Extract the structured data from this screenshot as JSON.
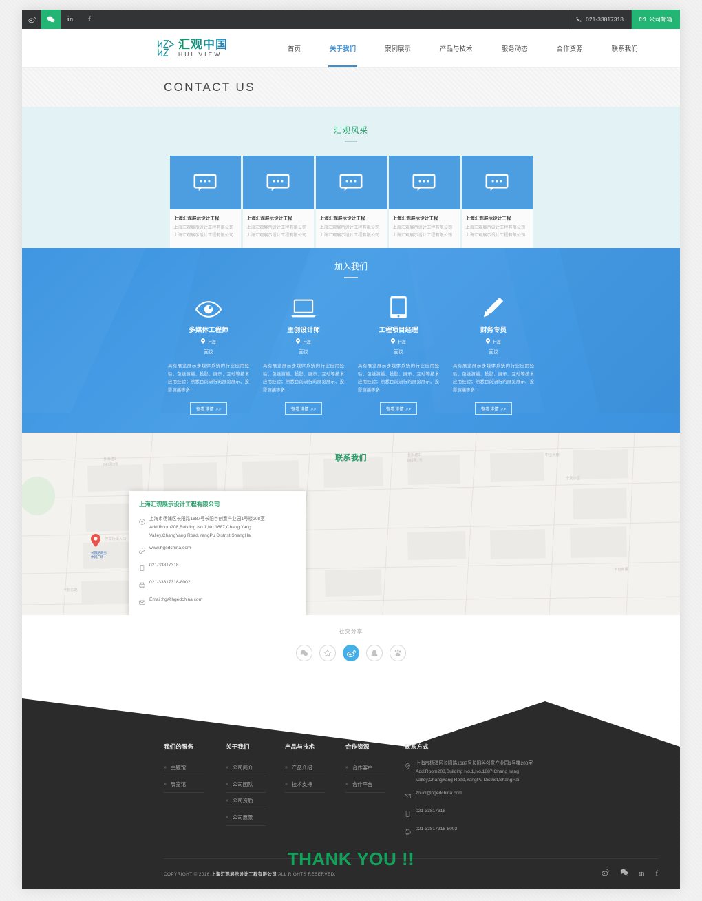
{
  "topbar": {
    "social": [
      {
        "name": "weibo",
        "label": "微博"
      },
      {
        "name": "wechat",
        "label": "微信"
      },
      {
        "name": "linkedin",
        "label": "in"
      },
      {
        "name": "facebook",
        "label": "f"
      }
    ],
    "phone": "021-33817318",
    "email_button": "公司邮箱"
  },
  "nav": {
    "logo_cn": "汇观中国",
    "logo_en": "HUI VIEW",
    "items": [
      {
        "label": "首页",
        "active": false
      },
      {
        "label": "关于我们",
        "active": true
      },
      {
        "label": "案例展示",
        "active": false
      },
      {
        "label": "产品与技术",
        "active": false
      },
      {
        "label": "服务动态",
        "active": false
      },
      {
        "label": "合作资源",
        "active": false
      },
      {
        "label": "联系我们",
        "active": false
      }
    ],
    "accent": "#3b8fd4"
  },
  "banner": {
    "title": "CONTACT US"
  },
  "section_cards": {
    "title": "汇观风采",
    "accent": "#22a06b",
    "bg": "#e3f2f5",
    "items": [
      {
        "title": "上海汇观展示设计工程",
        "line1": "上海汇观展示设计工程有限公司",
        "line2": "上海汇观展示设计工程有限公司"
      },
      {
        "title": "上海汇观展示设计工程",
        "line1": "上海汇观展示设计工程有限公司",
        "line2": "上海汇观展示设计工程有限公司"
      },
      {
        "title": "上海汇观展示设计工程",
        "line1": "上海汇观展示设计工程有限公司",
        "line2": "上海汇观展示设计工程有限公司"
      },
      {
        "title": "上海汇观展示设计工程",
        "line1": "上海汇观展示设计工程有限公司",
        "line2": "上海汇观展示设计工程有限公司"
      },
      {
        "title": "上海汇观展示设计工程",
        "line1": "上海汇观展示设计工程有限公司",
        "line2": "上海汇观展示设计工程有限公司"
      }
    ]
  },
  "section_join": {
    "title": "加入我们",
    "bg": "#3f95e1",
    "button_label": "查看详情 >>",
    "jobs": [
      {
        "icon": "eye-icon",
        "title": "多媒体工程师",
        "location": "上海",
        "salary": "面议",
        "desc": "具有展览展示多媒体系统的行业应用经验，包括演播、投影、展示、互动等技术应用经验；熟悉目前流行的展览展示、投影演播等多…"
      },
      {
        "icon": "laptop-icon",
        "title": "主创设计师",
        "location": "上海",
        "salary": "面议",
        "desc": "具有展览展示多媒体系统的行业应用经验，包括演播、投影、展示、互动等技术应用经验；熟悉目前流行的展览展示、投影演播等多…"
      },
      {
        "icon": "tablet-icon",
        "title": "工程项目经理",
        "location": "上海",
        "salary": "面议",
        "desc": "具有展览展示多媒体系统的行业应用经验，包括演播、投影、展示、互动等技术应用经验；熟悉目前流行的展览展示、投影演播等多…"
      },
      {
        "icon": "pencil-icon",
        "title": "财务专员",
        "location": "上海",
        "salary": "面议",
        "desc": "具有展览展示多媒体系统的行业应用经验，包括演播、投影、展示、互动等技术应用经验；熟悉目前流行的展览展示、投影演播等多…"
      }
    ]
  },
  "map_section": {
    "title": "联系我们",
    "info": {
      "company": "上海汇观展示设计工程有限公司",
      "address_cn": "上海市杨浦区长阳路1687号长阳谷创意产业园1号楼208室",
      "address_en1": "Add:Room208,Building No.1,No.1687,Chang Yang",
      "address_en2": "Valley,ChangYang Road,YangPu Distrist,ShangHai",
      "website": "www.hgedchina.com",
      "tel": "021-33817318",
      "fax": "021-33817318-8002",
      "email": "Email:hg@hgedchina.com"
    }
  },
  "share": {
    "label": "社交分享",
    "icons": [
      {
        "name": "wechat-icon",
        "active": false
      },
      {
        "name": "favorite-star-icon",
        "active": false
      },
      {
        "name": "weibo-icon",
        "active": true
      },
      {
        "name": "qq-icon",
        "active": false
      },
      {
        "name": "baidu-icon",
        "active": false
      }
    ],
    "active_color": "#45b0e8"
  },
  "footer": {
    "columns": [
      {
        "heading": "我们的服务",
        "links": [
          "主题馆",
          "展览馆"
        ]
      },
      {
        "heading": "关于我们",
        "links": [
          "公司简介",
          "公司团队",
          "公司资质",
          "公司愿景"
        ]
      },
      {
        "heading": "产品与技术",
        "links": [
          "产品介绍",
          "技术支持"
        ]
      },
      {
        "heading": "合作资源",
        "links": [
          "合作客户",
          "合作平台"
        ]
      }
    ],
    "contact": {
      "heading": "联系方式",
      "address_cn": "上海市杨浦区长阳路1687号长阳谷创意产业园1号楼208室",
      "address_en1": "Add:Room208,Building No.1,No.1687,Chang Yang",
      "address_en2": "Valley,ChangYang Road,YangPu Distrist,ShangHai",
      "email": "zoucl@hgedchina.com",
      "tel": "021-33817318",
      "fax": "021-33817318-8002"
    },
    "copyright_pre": "COPYRIGHT © 2016 ",
    "copyright_company": "上海汇观展示设计工程有限公司",
    "copyright_post": " ALL RIGHTS RESERVED.",
    "social": [
      "weibo",
      "wechat",
      "linkedin",
      "facebook"
    ]
  },
  "thanks": {
    "text": "THANK YOU !!",
    "color": "#13a05b"
  }
}
